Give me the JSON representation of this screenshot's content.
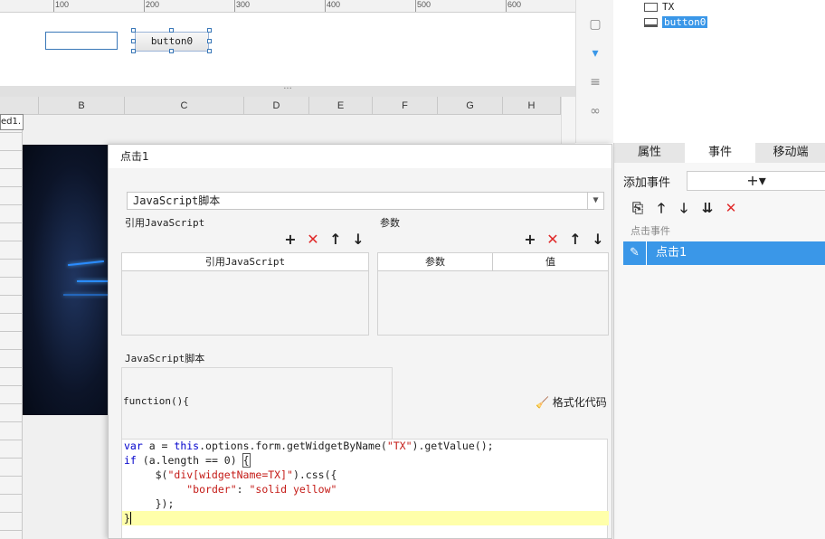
{
  "ruler": {
    "marks": [
      "100",
      "200",
      "300",
      "400",
      "500",
      "600"
    ]
  },
  "canvas": {
    "button_label": "button0"
  },
  "splitter": {
    "grip": "···"
  },
  "sheet": {
    "columns": [
      "B",
      "C",
      "D",
      "E",
      "F",
      "G",
      "H"
    ],
    "cell_label": "ed1."
  },
  "widget_tree": {
    "items": [
      {
        "label": "TX"
      },
      {
        "label": "button0",
        "selected": true
      }
    ]
  },
  "right_panel": {
    "tabs": [
      "属性",
      "事件",
      "移动端"
    ],
    "active_tab": "事件",
    "add_event_label": "添加事件",
    "add_event_glyph": "+▾",
    "toolbar_icons": [
      "copy-icon",
      "arrow-up-icon",
      "arrow-down-icon",
      "sort-down-icon",
      "delete-icon"
    ],
    "toolbar_glyphs": [
      "⎘",
      "🡑",
      "🡓",
      "⇊",
      "✕"
    ],
    "event_group": "点击事件",
    "events": [
      {
        "label": "点击1",
        "icon": "pencil-icon",
        "glyph": "✎"
      }
    ]
  },
  "dialog": {
    "title": "点击1",
    "type_select": "JavaScript脚本",
    "ref_js_section": "引用JavaScript",
    "params_section": "参数",
    "ref_table_header": "引用JavaScript",
    "params_table_headers": [
      "参数",
      "值"
    ],
    "script_section": "JavaScript脚本",
    "function_header": "function(){",
    "format_button": "格式化代码",
    "format_glyph": "🧹",
    "code_lines": [
      "var a = this.options.form.getWidgetByName(\"TX\").getValue();",
      "if (a.length == 0) {",
      "     $(\"div[widgetName=TX]\").css({",
      "          \"border\": \"solid yellow\"",
      "     });",
      "}"
    ]
  },
  "colors": {
    "selection": "#3a97e8",
    "danger": "#e02a2a",
    "keyword": "#0000cc",
    "string": "#c41a16",
    "current_line": "#ffffaa"
  }
}
